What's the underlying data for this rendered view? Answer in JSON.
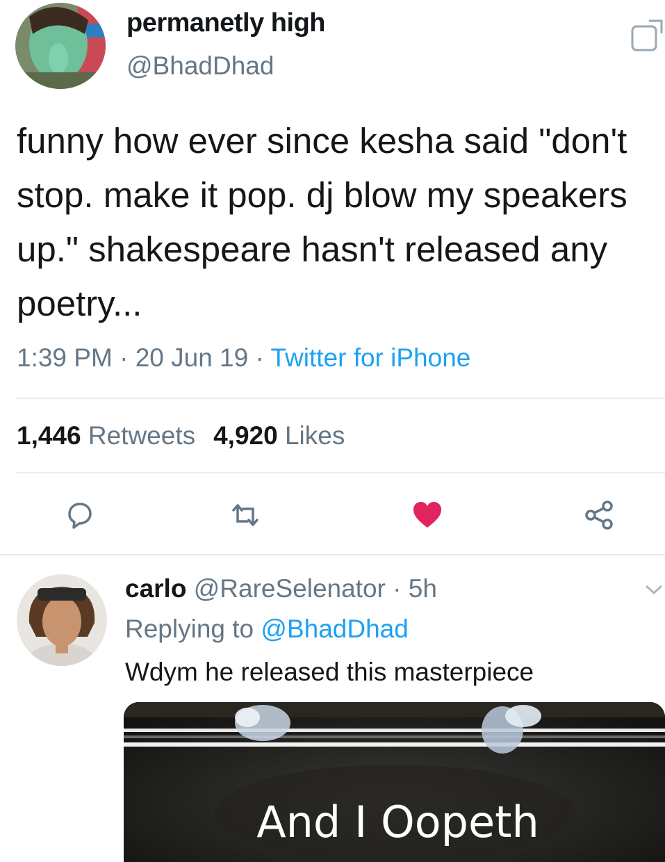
{
  "tweet": {
    "display_name": "permanetly high",
    "handle": "@BhadDhad",
    "text": "funny how ever since kesha said \"don't stop. make it pop. dj blow my speakers up.\" shakespeare hasn't released any poetry...",
    "time": "1:39 PM",
    "date": "20 Jun 19",
    "separator": "·",
    "source": "Twitter for iPhone",
    "retweet_count": "1,446",
    "retweet_label": "Retweets",
    "like_count": "4,920",
    "like_label": "Likes",
    "liked": true,
    "icons": {
      "follow": "follow-icon",
      "reply": "reply-icon",
      "retweet": "retweet-icon",
      "like": "heart-icon",
      "share": "share-icon"
    },
    "colors": {
      "like": "#e0245e",
      "link": "#1da1f2",
      "secondary_text": "#657786",
      "divider": "#e6ecf0"
    }
  },
  "reply": {
    "display_name": "carlo",
    "handle": "@RareSelenator",
    "separator": "·",
    "age": "5h",
    "replying_label": "Replying to",
    "replying_to": "@BhadDhad",
    "text": "Wdym he released this masterpiece",
    "media_caption": "And I Oopeth",
    "icons": {
      "menu": "chevron-down-icon"
    }
  }
}
